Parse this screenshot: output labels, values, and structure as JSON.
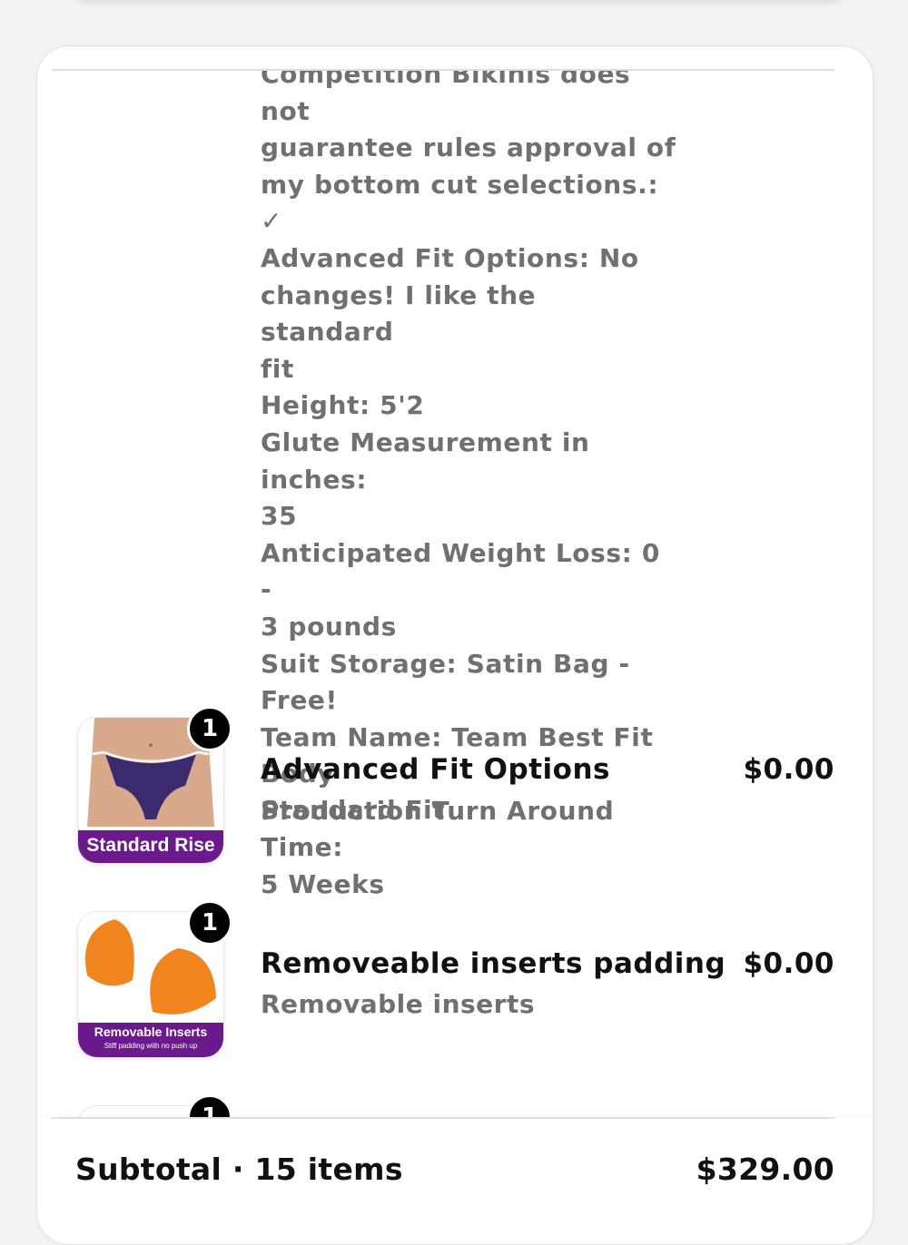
{
  "cart": {
    "line_item_properties": [
      "Competition Bikinis does not",
      "guarantee rules approval of",
      "my bottom cut selections.: ✓",
      "Advanced Fit Options: No",
      "changes! I like the standard",
      "fit",
      "Height: 5'2",
      "Glute Measurement in inches:",
      "35",
      "Anticipated Weight Loss: 0 -",
      "3 pounds",
      "Suit Storage: Satin Bag -",
      "Free!",
      "Team Name: Team Best Fit",
      "Body",
      "Production Turn Around Time:",
      "5 Weeks"
    ],
    "items": [
      {
        "title": "Advanced Fit Options",
        "variant": "Standard Fit",
        "price": "$0.00",
        "quantity": "1",
        "image_banner": "Standard Rise"
      },
      {
        "title": "Removeable inserts padding",
        "variant": "Removable inserts",
        "price": "$0.00",
        "quantity": "1",
        "image_banner": "Removable Inserts",
        "image_banner_sub": "Stiff padding with no push up"
      },
      {
        "quantity": "1"
      }
    ],
    "subtotal_label": "Subtotal · 15 items",
    "subtotal_value": "$329.00"
  }
}
